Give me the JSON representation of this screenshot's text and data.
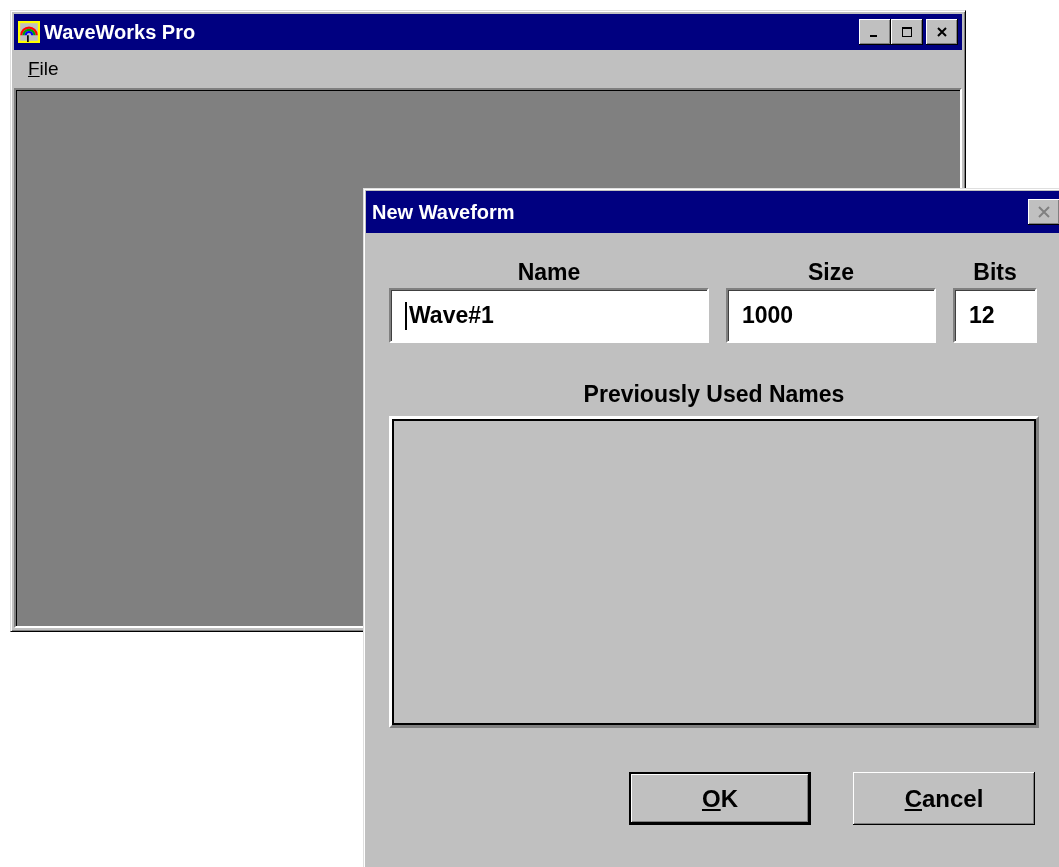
{
  "main_window": {
    "title": "WaveWorks Pro",
    "menu": [
      {
        "label": "File"
      }
    ]
  },
  "dialog": {
    "title": "New Waveform",
    "close_disabled": true,
    "fields": [
      {
        "label": "Name",
        "value": "Wave#1",
        "focused": true
      },
      {
        "label": "Size",
        "value": "1000",
        "focused": false
      },
      {
        "label": "Bits",
        "value": "12",
        "focused": false
      }
    ],
    "list_label": "Previously Used Names",
    "buttons": [
      {
        "label": "OK",
        "default": true
      },
      {
        "label": "Cancel",
        "default": false
      }
    ]
  }
}
